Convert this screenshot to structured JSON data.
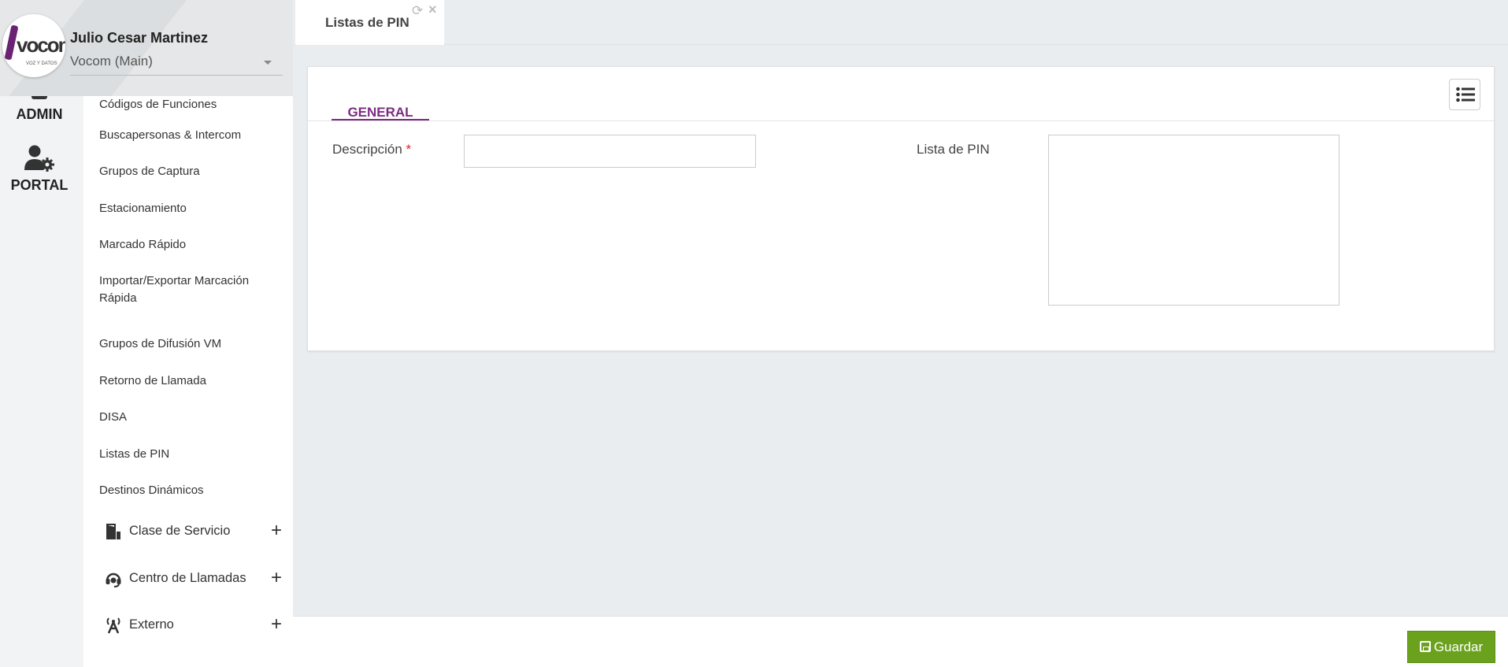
{
  "user": {
    "name": "Julio Cesar Martinez",
    "company": "Vocom (Main)",
    "logo_text": "vocom",
    "logo_subtext": "VOZ Y DATOS"
  },
  "rail": {
    "admin_label": "ADMIN",
    "portal_label": "PORTAL"
  },
  "submenu": {
    "items": [
      "Códigos de Funciones",
      "Buscapersonas & Intercom",
      "Grupos de Captura",
      "Estacionamiento",
      "Marcado Rápido",
      "Importar/Exportar Marcación Rápida",
      "Grupos de Difusión VM",
      "Retorno de Llamada",
      "DISA",
      "Listas de PIN",
      "Destinos Dinámicos"
    ],
    "groups": [
      {
        "label": "Clase de Servicio",
        "icon": "door-icon",
        "toggle": "+"
      },
      {
        "label": "Centro de Llamadas",
        "icon": "headset-icon",
        "toggle": "+"
      },
      {
        "label": "Externo",
        "icon": "antenna-icon",
        "toggle": "+"
      }
    ]
  },
  "tabs": [
    {
      "label": "Listas de PIN",
      "refresh": "⟳",
      "close": "×"
    }
  ],
  "form": {
    "tab_label": "GENERAL",
    "description_label": "Descripción",
    "required_mark": "*",
    "description_value": "",
    "pin_list_label": "Lista de PIN",
    "pin_list_value": ""
  },
  "footer": {
    "save_label": "Guardar"
  },
  "colors": {
    "accent": "#7b2c82",
    "save": "#6aa21e",
    "required": "#d9262b"
  }
}
